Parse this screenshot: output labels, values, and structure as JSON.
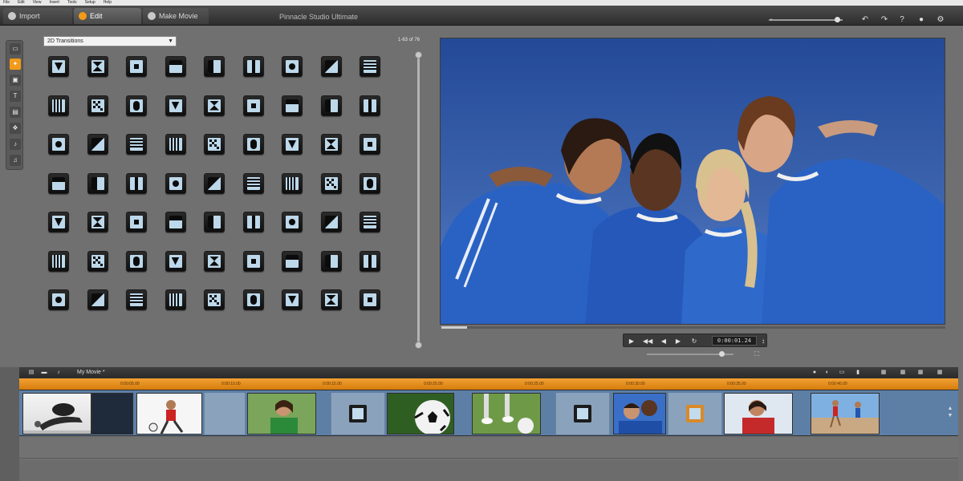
{
  "menu": [
    "File",
    "Edit",
    "View",
    "Insert",
    "Tools",
    "Setup",
    "Help"
  ],
  "tabs": [
    {
      "label": "Import",
      "active": false
    },
    {
      "label": "Edit",
      "active": true
    },
    {
      "label": "Make Movie",
      "active": false
    }
  ],
  "app_title": "Pinnacle Studio Ultimate",
  "library": {
    "category": "2D Transitions",
    "page_count": "1-63 of 76"
  },
  "transition_icons": [
    "fade-down",
    "clock-wipe",
    "zoom-center",
    "x-wipe",
    "top-bar",
    "bottom-bar",
    "left-bar",
    "right-bar",
    "corner-wipe",
    "corner-in",
    "corner-out",
    "corner-diagonal",
    "center-expand",
    "split-horizontal",
    "split-vertical",
    "push-up",
    "push-down",
    "push-left",
    "slide-left",
    "slide-right",
    "squeeze-h",
    "squeeze-v",
    "iris-h",
    "iris-v",
    "corner-tl",
    "corner-tr",
    "corner-br",
    "diagonal-tl",
    "diagonal-tr",
    "diagonal-bl",
    "diagonal-br",
    "arrow-in",
    "arrow-out",
    "quarter-tl",
    "quarter-tr",
    "quarter-bl",
    "circle",
    "diamond",
    "heart",
    "star",
    "horizontal-blinds",
    "solid-block",
    "vertical-blinds",
    "checker",
    "step",
    "diagonal-split",
    "stair-step",
    "half-diagonal",
    "arrow-wipe",
    "center-split",
    "keyhole",
    "bars-up",
    "bars-down",
    "checker-diamond",
    "random-blocks",
    "mosaic",
    "dots",
    "fine-mosaic",
    "checker-dots",
    "stripes",
    "rounded-corner",
    "rounded-rect",
    "shield"
  ],
  "preview": {
    "timecode": "0:00:01.24"
  },
  "timeline": {
    "title": "My Movie *",
    "ruler_ticks": [
      "0:00:05.00",
      "0:00:10.00",
      "0:00:15.00",
      "0:00:20.00",
      "0:00:25.00",
      "0:00:30.00",
      "0:00:35.00",
      "0:00:40.00",
      "0:00:45.00",
      "0:00:50.00"
    ],
    "clips": [
      "soccer-header",
      "girl-kicking",
      "girl-smiling",
      "soccer-ball",
      "feet-ball",
      "two-girls",
      "girl-portrait",
      "beach-runner"
    ]
  },
  "colors": {
    "accent": "#f29a1a",
    "ruler": "#e48f1e",
    "track": "#5d7fa6",
    "sky": "#3f66b0",
    "jersey": "#2a62c4"
  }
}
